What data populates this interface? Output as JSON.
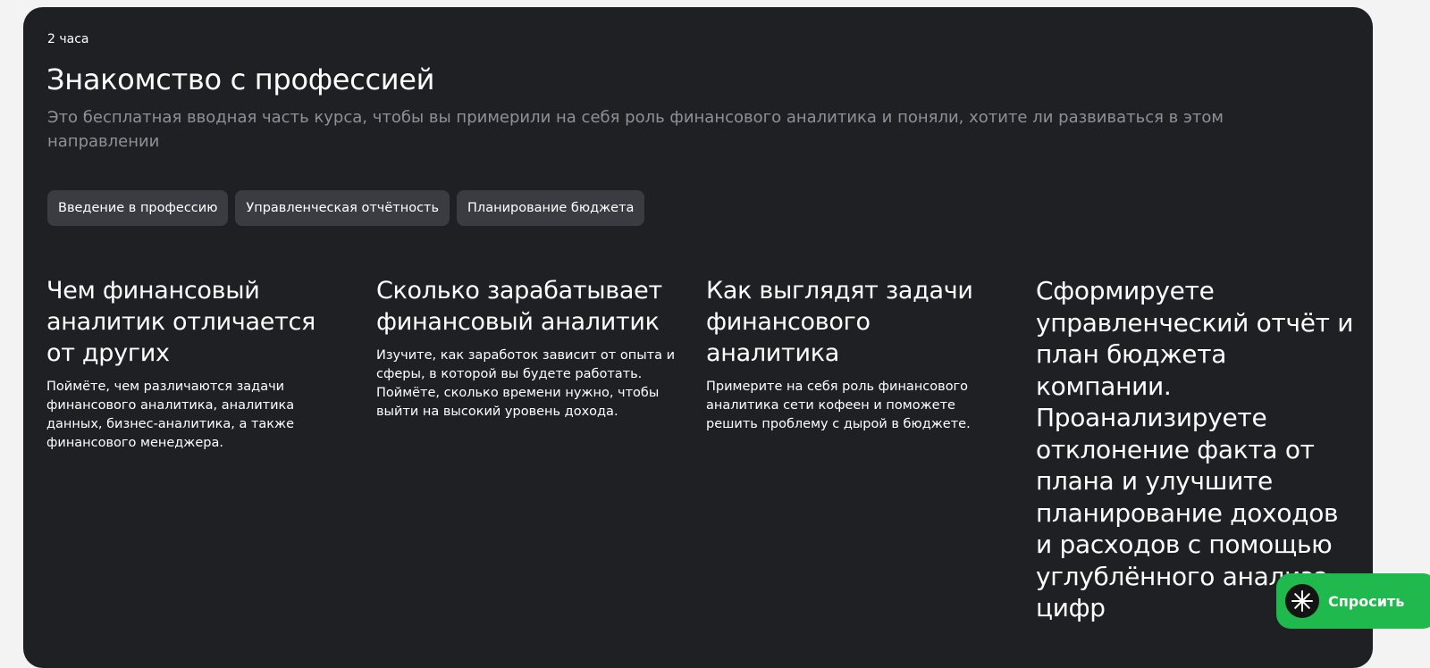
{
  "section": {
    "duration": "2 часа",
    "title": "Знакомство с профессией",
    "subtitle": "Это бесплатная вводная часть курса, чтобы вы примерили на себя роль финансового аналитика и поняли, хотите ли развиваться в этом направлении",
    "tags": [
      "Введение в профессию",
      "Управленческая отчётность",
      "Планирование бюджета"
    ]
  },
  "columns": [
    {
      "heading": "Чем финансовый аналитик отличается от других",
      "text": "Поймёте, чем различаются задачи финансового аналитика, аналитика данных, бизнес-аналитика, а также финансового менеджера."
    },
    {
      "heading": "Сколько зарабатывает финансовый аналитик",
      "text": "Изучите, как заработок зависит от опыта и сферы, в которой вы будете работать. Поймёте, сколько времени нужно, чтобы выйти на высокий уровень дохода."
    },
    {
      "heading": "Как выглядят задачи финансового аналитика",
      "text": "Примерите на себя роль финансового аналитика сети кофеен и поможете решить проблему с дырой в бюджете."
    },
    {
      "heading": "Сформируете управленческий отчёт и план бюджета компании. Проанализируете отклонение факта от плана и улучшите планирование доходов и расходов с помощью углублённого анализа цифр",
      "text": ""
    }
  ],
  "ask_button": {
    "label": "Спросить",
    "icon": "sparkle-icon",
    "color": "#1fb94d"
  },
  "colors": {
    "card_background": "#1f2024",
    "tag_background": "#3a3c42",
    "subtitle_text": "#8e9096"
  }
}
